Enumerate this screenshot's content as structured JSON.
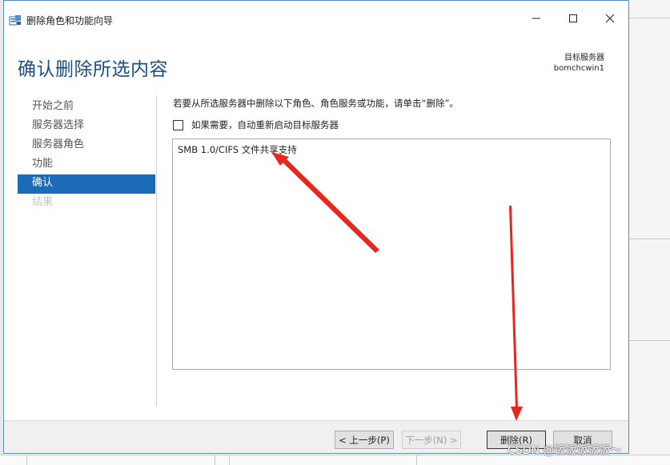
{
  "window": {
    "title": "删除角色和功能向导",
    "app_icon": "server-manager-icon",
    "controls": [
      "minimize-icon",
      "maximize-icon",
      "close-icon"
    ]
  },
  "header": {
    "page_title": "确认删除所选内容",
    "target_server_label": "目标服务器",
    "target_server_name": "bomchcwin1"
  },
  "nav": {
    "items": [
      {
        "label": "开始之前",
        "state": "normal"
      },
      {
        "label": "服务器选择",
        "state": "normal"
      },
      {
        "label": "服务器角色",
        "state": "normal"
      },
      {
        "label": "功能",
        "state": "normal"
      },
      {
        "label": "确认",
        "state": "active"
      },
      {
        "label": "结果",
        "state": "disabled"
      }
    ]
  },
  "content": {
    "instruction": "若要从所选服务器中删除以下角色、角色服务或功能，请单击“删除”。",
    "restart_checkbox_label": "如果需要，自动重新启动目标服务器",
    "restart_checked": false,
    "items": [
      "SMB 1.0/CIFS 文件共享支持"
    ]
  },
  "footer": {
    "prev_label": "< 上一步(P)",
    "next_label": "下一步(N) >",
    "delete_label": "删除(R)",
    "cancel_label": "取消"
  },
  "watermark": "CSDN @饭饭饭饭饭～",
  "colors": {
    "accent": "#1c6bb8",
    "title": "#1a4f86",
    "annotation_arrow": "#e8261e"
  }
}
